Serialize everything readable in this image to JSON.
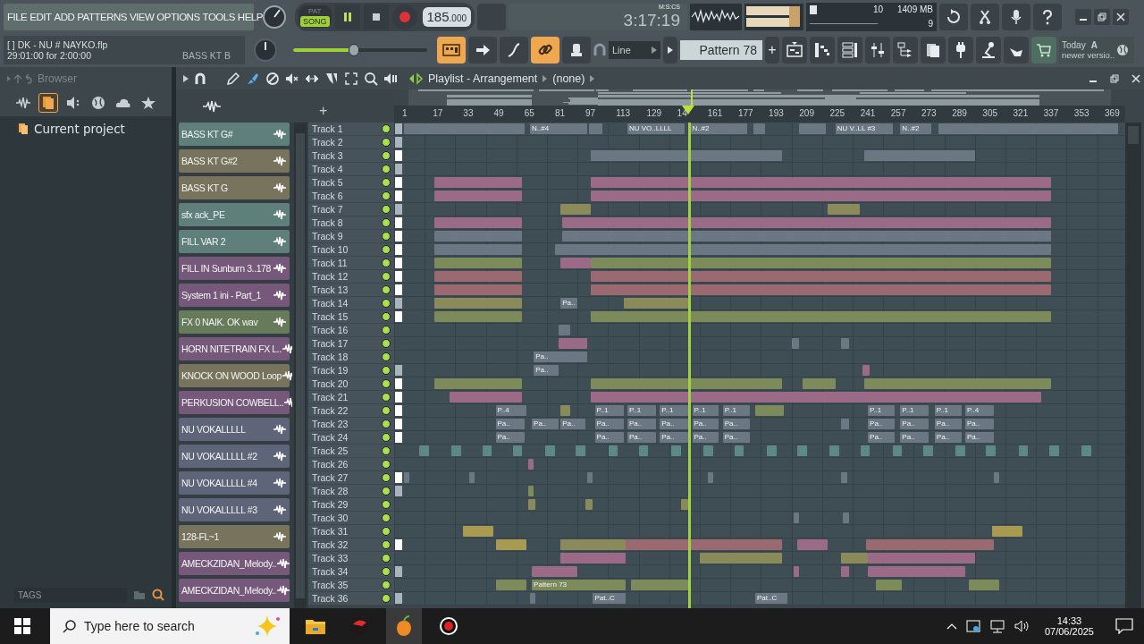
{
  "menu": [
    "FILE",
    "EDIT",
    "ADD",
    "PATTERNS",
    "VIEW",
    "OPTIONS",
    "TOOLS",
    "HELP"
  ],
  "transport": {
    "modes": [
      {
        "label": "PAT",
        "selected": false
      },
      {
        "label": "SONG",
        "selected": true
      }
    ],
    "playing": true,
    "tempo": "185",
    "tempo_fraction": ".000",
    "time": "3:17:19",
    "time_format": "M:S:CS"
  },
  "song_info": {
    "title": "[ ] DK - NU # NAYKO.flp",
    "hint": "29:01:00 for 2:00:00",
    "channel": "BASS KT B"
  },
  "master": {
    "level": 0.45
  },
  "cpu": {
    "cpu": "10",
    "memory": "1409 MB",
    "polyphony": "9"
  },
  "snap": "Line",
  "pattern": "Pattern 78",
  "pattern_add": "+",
  "news": {
    "label": "Today",
    "title": "A",
    "text": "newer versio.."
  },
  "browser": {
    "title": "Browser",
    "tabs": [
      {
        "kind": "waveform",
        "selected": false
      },
      {
        "kind": "files",
        "selected": true
      },
      {
        "kind": "speaker",
        "selected": false
      },
      {
        "kind": "globe",
        "selected": false
      },
      {
        "kind": "cloud",
        "selected": false
      },
      {
        "kind": "star",
        "selected": false
      }
    ],
    "items": [
      "Current project"
    ],
    "tags": "TAGS"
  },
  "playlist": {
    "title": "Playlist - Arrangement",
    "pattern": "(none)",
    "add": "+",
    "ruler": [
      "1",
      "17",
      "33",
      "49",
      "65",
      "81",
      "97",
      "113",
      "129",
      "14",
      "161",
      "177",
      "193",
      "209",
      "225",
      "241",
      "257",
      "273",
      "289",
      "305",
      "321",
      "337",
      "353",
      "369"
    ],
    "playhead": {
      "level": 0.402
    },
    "picker": [
      {
        "name": "BASS KT G#",
        "color": "#5f7f7a"
      },
      {
        "name": "BASS KT G#2",
        "color": "#77735c"
      },
      {
        "name": "BASS KT G",
        "color": "#77735c"
      },
      {
        "name": "sfx ack_PE",
        "color": "#5f7f7a"
      },
      {
        "name": "FILL VAR 2",
        "color": "#5f7f7a"
      },
      {
        "name": "FILL IN Sunburn 3..178",
        "color": "#76587a"
      },
      {
        "name": "System 1 ini - Part_1",
        "color": "#76587a"
      },
      {
        "name": "FX 0 NAIK. OK wav",
        "color": "#677a5a"
      },
      {
        "name": "HORN NITETRAIN FX L..",
        "color": "#76587a"
      },
      {
        "name": "KNOCK ON WOOD Loop",
        "color": "#77735c"
      },
      {
        "name": "PERKUSION COWBELL..",
        "color": "#76587a"
      },
      {
        "name": "NU VOKALLLLL",
        "color": "#5e6578"
      },
      {
        "name": "NU VOKALLLLL #2",
        "color": "#5e6578"
      },
      {
        "name": "NU VOKALLLLL #4",
        "color": "#5e6578"
      },
      {
        "name": "NU VOKALLLLL #3",
        "color": "#5e6578"
      },
      {
        "name": "128-FL~1",
        "color": "#77735c"
      },
      {
        "name": "AMECKZIDAN_Melody..",
        "color": "#76587a"
      },
      {
        "name": "AMECKZIDAN_Melody..",
        "color": "#76587a"
      }
    ],
    "tracks": [
      {
        "name": "Track 1",
        "enabled": true,
        "color": "#aab4bc",
        "clips": [
          {
            "color": "#6b7884"
          },
          {
            "color": "#6b7884",
            "label": "N..#4"
          },
          {
            "color": "#6b7884"
          },
          {
            "color": "#6b7884",
            "label": "NU VO..LLLL"
          },
          {
            "color": "#6b7884",
            "label": "N..#2"
          },
          {
            "color": "#6b7884"
          },
          {
            "color": "#6b7884"
          },
          {
            "color": "#6b7884",
            "label": "NU V..LL #3"
          },
          {
            "color": "#6b7884",
            "label": "N..#2"
          },
          {
            "color": "#6b7884"
          }
        ]
      },
      {
        "name": "Track 2",
        "enabled": true,
        "color": "#aab4bc"
      },
      {
        "name": "Track 3",
        "enabled": true,
        "color": "#ffffff",
        "clips": [
          {
            "color": "#6b7884"
          },
          {
            "color": "#6b7884"
          }
        ]
      },
      {
        "name": "Track 4",
        "enabled": true,
        "color": "#aab4bc"
      },
      {
        "name": "Track 5",
        "enabled": true,
        "color": "#ffffff",
        "clips": [
          {
            "color": "#9a6a86"
          },
          {
            "color": "#9a6a86"
          }
        ]
      },
      {
        "name": "Track 6",
        "enabled": true,
        "color": "#ffffff",
        "clips": [
          {
            "color": "#9a6a86"
          },
          {
            "color": "#9a6a86"
          }
        ]
      },
      {
        "name": "Track 7",
        "enabled": true,
        "color": "#aab4bc",
        "clips": [
          {
            "color": "#8a8a5a"
          },
          {
            "color": "#8a8a5a"
          }
        ]
      },
      {
        "name": "Track 8",
        "enabled": true,
        "color": "#ffffff",
        "clips": [
          {
            "color": "#9a6a86"
          },
          {
            "color": "#9a6a86"
          }
        ]
      },
      {
        "name": "Track 9",
        "enabled": true,
        "color": "#ffffff",
        "clips": [
          {
            "color": "#6b7884"
          },
          {
            "color": "#6b7884"
          }
        ]
      },
      {
        "name": "Track 10",
        "enabled": true,
        "color": "#ffffff",
        "clips": [
          {
            "color": "#6b7884"
          },
          {
            "color": "#6b7884"
          }
        ]
      },
      {
        "name": "Track 11",
        "enabled": true,
        "color": "#ffffff",
        "clips": [
          {
            "color": "#7d8a5a"
          },
          {
            "color": "#9a6a86"
          },
          {
            "color": "#7d8a5a"
          }
        ]
      },
      {
        "name": "Track 12",
        "enabled": true,
        "color": "#ffffff",
        "clips": [
          {
            "color": "#9a6a70"
          },
          {
            "color": "#9a6a70"
          }
        ]
      },
      {
        "name": "Track 13",
        "enabled": true,
        "color": "#ffffff",
        "clips": [
          {
            "color": "#9a6a70"
          },
          {
            "color": "#9a6a70"
          }
        ]
      },
      {
        "name": "Track 14",
        "enabled": true,
        "color": "#aab4bc",
        "clips": [
          {
            "color": "#8a8a5a"
          },
          {
            "color": "#6b7884",
            "label": "Pa.."
          },
          {
            "color": "#8a8a5a"
          }
        ]
      },
      {
        "name": "Track 15",
        "enabled": true,
        "color": "#ffffff",
        "clips": [
          {
            "color": "#7d8a5a"
          },
          {
            "color": "#7d8a5a"
          }
        ]
      },
      {
        "name": "Track 16",
        "enabled": true,
        "clips": [
          {
            "color": "#6b7884"
          }
        ]
      },
      {
        "name": "Track 17",
        "enabled": true,
        "clips": [
          {
            "color": "#9a6a86"
          },
          {
            "color": "#6b7884"
          },
          {
            "color": "#6b7884"
          }
        ]
      },
      {
        "name": "Track 18",
        "enabled": true,
        "clips": [
          {
            "color": "#6b7884",
            "label": "Pa.."
          }
        ]
      },
      {
        "name": "Track 19",
        "enabled": true,
        "color": "#aab4bc",
        "clips": [
          {
            "color": "#6b7884",
            "label": "Pa.."
          },
          {
            "color": "#9a6a86"
          }
        ]
      },
      {
        "name": "Track 20",
        "enabled": true,
        "color": "#ffffff",
        "clips": [
          {
            "color": "#7d8a5a"
          },
          {
            "color": "#7d8a5a"
          },
          {
            "color": "#7d8a5a"
          },
          {
            "color": "#7d8a5a"
          }
        ]
      },
      {
        "name": "Track 21",
        "enabled": true,
        "color": "#ffffff",
        "clips": [
          {
            "color": "#9a6a86"
          },
          {
            "color": "#9a6a86"
          }
        ]
      },
      {
        "name": "Track 22",
        "enabled": true,
        "color": "#ffffff",
        "clips": [
          {
            "color": "#6b7884",
            "label": "P..4"
          },
          {
            "color": "#8a8a5a"
          },
          {
            "color": "#6b7884",
            "label": "P..1"
          },
          {
            "color": "#6b7884",
            "label": "P..1"
          },
          {
            "color": "#6b7884",
            "label": "P..1"
          },
          {
            "color": "#6b7884",
            "label": "P..1"
          },
          {
            "color": "#6b7884",
            "label": "P..1"
          },
          {
            "color": "#7d8a5a"
          },
          {
            "color": "#6b7884",
            "label": "P..1"
          },
          {
            "color": "#6b7884",
            "label": "P..1"
          },
          {
            "color": "#6b7884",
            "label": "P..1"
          },
          {
            "color": "#6b7884",
            "label": "P..4"
          }
        ]
      },
      {
        "name": "Track 23",
        "enabled": true,
        "color": "#ffffff",
        "clips": [
          {
            "color": "#6b7884",
            "label": "Pa.."
          },
          {
            "color": "#6b7884",
            "label": "Pa.."
          },
          {
            "color": "#6b7884",
            "label": "Pa.."
          },
          {
            "color": "#6b7884",
            "label": "Pa.."
          },
          {
            "color": "#6b7884",
            "label": "Pa.."
          },
          {
            "color": "#6b7884",
            "label": "Pa.."
          },
          {
            "color": "#6b7884",
            "label": "Pa.."
          },
          {
            "color": "#6b7884",
            "label": "Pa.."
          },
          {
            "color": "#6b7884"
          },
          {
            "color": "#6b7884",
            "label": "Pa.."
          },
          {
            "color": "#6b7884",
            "label": "Pa.."
          },
          {
            "color": "#6b7884",
            "label": "Pa.."
          },
          {
            "color": "#6b7884",
            "label": "Pa.."
          }
        ]
      },
      {
        "name": "Track 24",
        "enabled": true,
        "color": "#ffffff",
        "clips": [
          {
            "color": "#6b7884",
            "label": "Pa.."
          },
          {
            "color": "#6b7884",
            "label": "Pa.."
          },
          {
            "color": "#6b7884",
            "label": "Pa.."
          },
          {
            "color": "#6b7884",
            "label": "Pa.."
          },
          {
            "color": "#6b7884",
            "label": "Pa.."
          },
          {
            "color": "#6b7884",
            "label": "Pa.."
          },
          {
            "color": "#6b7884",
            "label": "Pa.."
          },
          {
            "color": "#6b7884",
            "label": "Pa.."
          },
          {
            "color": "#6b7884",
            "label": "Pa.."
          },
          {
            "color": "#6b7884",
            "label": "Pa.."
          }
        ]
      },
      {
        "name": "Track 25",
        "enabled": true,
        "clips": [
          {
            "color": "#5e8884"
          },
          {
            "color": "#5e8884"
          },
          {
            "color": "#5e8884"
          },
          {
            "color": "#5e8884"
          },
          {
            "color": "#5e8884"
          },
          {
            "color": "#5e8884"
          },
          {
            "color": "#5e8884"
          },
          {
            "color": "#5e8884"
          },
          {
            "color": "#5e8884"
          },
          {
            "color": "#5e8884"
          },
          {
            "color": "#5e8884"
          },
          {
            "color": "#5e8884"
          },
          {
            "color": "#5e8884"
          },
          {
            "color": "#5e8884"
          },
          {
            "color": "#5e8884"
          },
          {
            "color": "#5e8884"
          },
          {
            "color": "#5e8884"
          },
          {
            "color": "#5e8884"
          },
          {
            "color": "#5e8884"
          },
          {
            "color": "#5e8884"
          },
          {
            "color": "#5e8884"
          },
          {
            "color": "#5e8884"
          }
        ]
      },
      {
        "name": "Track 26",
        "enabled": true,
        "clips": [
          {
            "color": "#9a6a86"
          }
        ]
      },
      {
        "name": "Track 27",
        "enabled": true,
        "color": "#ffffff",
        "clips": [
          {
            "color": "#6b7884"
          },
          {
            "color": "#6b7884"
          },
          {
            "color": "#6b7884"
          },
          {
            "color": "#6b7884"
          },
          {
            "color": "#6b7884"
          },
          {
            "color": "#6b7884"
          }
        ]
      },
      {
        "name": "Track 28",
        "enabled": true,
        "color": "#aab4bc",
        "clips": [
          {
            "color": "#7d8a5a"
          }
        ]
      },
      {
        "name": "Track 29",
        "enabled": true,
        "clips": [
          {
            "color": "#8a8a5a"
          },
          {
            "color": "#8a8a5a"
          },
          {
            "color": "#8a8a5a"
          }
        ]
      },
      {
        "name": "Track 30",
        "enabled": true,
        "clips": [
          {
            "color": "#6b7884"
          },
          {
            "color": "#6b7884"
          }
        ]
      },
      {
        "name": "Track 31",
        "enabled": true,
        "clips": [
          {
            "color": "#a89a50"
          },
          {
            "color": "#a89a50"
          }
        ]
      },
      {
        "name": "Track 32",
        "enabled": true,
        "color": "#ffffff",
        "clips": [
          {
            "color": "#a89a50"
          },
          {
            "color": "#8a8a5a"
          },
          {
            "color": "#9a6a70"
          },
          {
            "color": "#9a6a86"
          },
          {
            "color": "#9a6a70"
          }
        ]
      },
      {
        "name": "Track 33",
        "enabled": true,
        "clips": [
          {
            "color": "#9a6a86"
          },
          {
            "color": "#8a8a5a"
          },
          {
            "color": "#8a8a5a"
          },
          {
            "color": "#9a6a86"
          }
        ]
      },
      {
        "name": "Track 34",
        "enabled": true,
        "color": "#aab4bc",
        "clips": [
          {
            "color": "#9a6a86"
          },
          {
            "color": "#9a6a86"
          },
          {
            "color": "#9a6a86"
          },
          {
            "color": "#9a6a86"
          }
        ]
      },
      {
        "name": "Track 35",
        "enabled": true,
        "clips": [
          {
            "color": "#7d8a5a"
          },
          {
            "color": "#7d8a5a",
            "label": "Pattern 73"
          },
          {
            "color": "#7d8a5a"
          },
          {
            "color": "#7d8a5a"
          },
          {
            "color": "#7d8a5a"
          }
        ]
      },
      {
        "name": "Track 36",
        "enabled": true,
        "color": "#aab4bc",
        "clips": [
          {
            "color": "#6b7884"
          },
          {
            "color": "#6b7884",
            "label": "Pat..C"
          },
          {
            "color": "#6b7884",
            "label": "Pat..C"
          }
        ]
      }
    ]
  },
  "taskbar": {
    "search": {
      "placeholder": "Type here to search"
    },
    "time": "14:33",
    "date": "07/06/2025"
  }
}
